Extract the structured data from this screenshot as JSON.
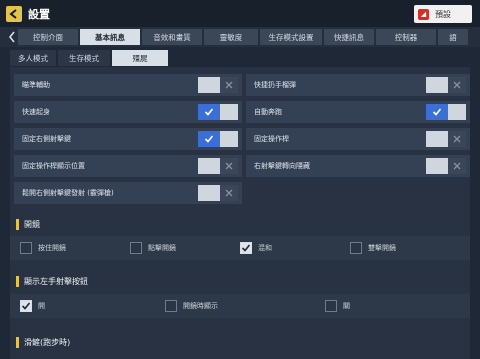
{
  "header": {
    "title": "設置",
    "preset_label": "預設",
    "preset_icon": "game-logo-icon"
  },
  "tabs": [
    {
      "label": "控制介面",
      "active": false
    },
    {
      "label": "基本訊息",
      "active": true
    },
    {
      "label": "音效和畫質",
      "active": false
    },
    {
      "label": "靈敏度",
      "active": false
    },
    {
      "label": "生存模式設置",
      "active": false
    },
    {
      "label": "快捷訊息",
      "active": false
    },
    {
      "label": "控制器",
      "active": false
    },
    {
      "label": "語",
      "active": false
    }
  ],
  "subtabs": [
    {
      "label": "多人模式",
      "active": false
    },
    {
      "label": "生存模式",
      "active": false
    },
    {
      "label": "殭屍",
      "active": true
    }
  ],
  "options": {
    "left": [
      {
        "label": "瞄準輔助",
        "on": false
      },
      {
        "label": "快速起身",
        "on": true
      },
      {
        "label": "固定右側射擊鍵",
        "on": true
      },
      {
        "label": "固定操作桿顯示位置",
        "on": false
      },
      {
        "label": "鬆開右側射擊鍵發射 (霰彈槍)",
        "on": false
      }
    ],
    "right": [
      {
        "label": "快捷扔手榴彈",
        "on": false
      },
      {
        "label": "自動奔跑",
        "on": true
      },
      {
        "label": "固定操作桿",
        "on": false
      },
      {
        "label": "右射擊鍵轉向隱藏",
        "on": false
      }
    ]
  },
  "sections": {
    "scope": {
      "title": "開鏡",
      "items": [
        {
          "label": "按住開鏡",
          "checked": false
        },
        {
          "label": "點擊開鏡",
          "checked": false
        },
        {
          "label": "混和",
          "checked": true
        },
        {
          "label": "雙擊開鏡",
          "checked": false
        }
      ]
    },
    "left_fire": {
      "title": "顯示左手射擊按鈕",
      "items": [
        {
          "label": "開",
          "checked": true
        },
        {
          "label": "開鏡時顯示",
          "checked": false
        },
        {
          "label": "關",
          "checked": false
        }
      ]
    },
    "slide": {
      "title": "滑鏟(跑步時)"
    }
  }
}
